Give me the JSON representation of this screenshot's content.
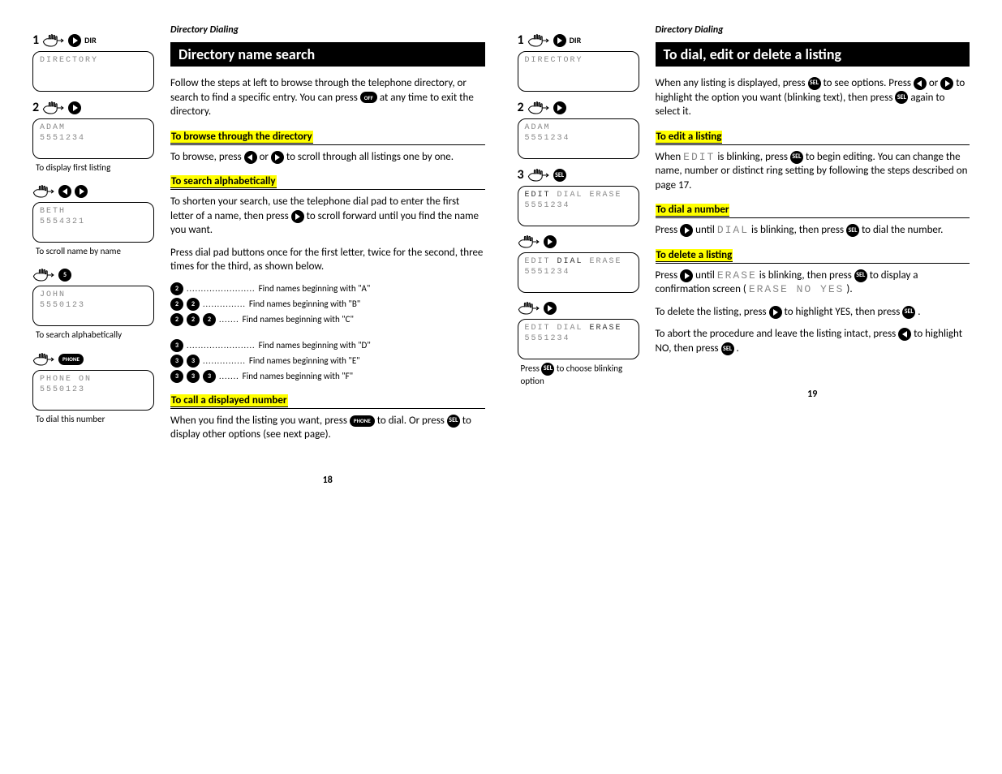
{
  "left": {
    "section": "Directory Dialing",
    "title": "Directory name search",
    "intro1": "Follow the steps at left to browse through the telephone directory, or search to find a specific entry. You can press ",
    "intro2": " at any time to exit the directory.",
    "off_label": "OFF",
    "sub_browse": "To browse through the directory",
    "browse1": "To browse, press ",
    "browse2": " or ",
    "browse3": " to scroll through all listings one by one.",
    "sub_search": "To search alphabetically",
    "search1": "To shorten your search, use the telephone dial pad to enter the first letter of a name, then press ",
    "search2": " to scroll forward until you find the name you want.",
    "search3": "Press dial pad buttons once for the first letter, twice for the second, three times for the third, as shown below.",
    "key2": "2",
    "key3": "3",
    "find_a": "Find names beginning with \"A\"",
    "find_b": "Find names beginning with \"B\"",
    "find_c": "Find names beginning with \"C\"",
    "find_d": "Find names beginning with \"D\"",
    "find_e": "Find names beginning with \"E\"",
    "find_f": "Find names beginning with \"F\"",
    "sub_call": "To call a displayed number",
    "call1": "When you find the listing you want, press ",
    "call2": " to dial. Or press ",
    "call3": " to display other options (see next page).",
    "phone_label": "PHONE",
    "sel_label": "SEL",
    "pagenum": "18",
    "sidebar": {
      "dir_label": "DIR",
      "s1_lcd": "DIRECTORY",
      "s2_lcd1": "ADAM",
      "s2_lcd2": "5551234",
      "s2_cap": "To display first listing",
      "s3_lcd1": "BETH",
      "s3_lcd2": "5554321",
      "s3_cap": "To scroll name by name",
      "key5": "5",
      "s4_lcd1": "JOHN",
      "s4_lcd2": "5550123",
      "s4_cap": "To search alphabetically",
      "s5_lcd1": "PHONE ON",
      "s5_lcd2": "5550123",
      "s5_cap": "To dial this number"
    }
  },
  "right": {
    "section": "Directory Dialing",
    "title": "To dial, edit or delete a listing",
    "intro1": "When any listing is displayed, press ",
    "intro2": " to see options. Press ",
    "intro3": " or ",
    "intro4": " to highlight the option you want (blinking text), then press ",
    "intro5": " again to select it.",
    "sel_label": "SEL",
    "sub_edit": "To edit a listing",
    "edit1a": "When ",
    "edit_word": "EDIT",
    "edit1b": " is blinking, press ",
    "edit1c": " to begin editing. You can change the name, number or distinct ring setting by following the steps described on page 17.",
    "sub_dial": "To dial a number",
    "dial1a": "Press ",
    "dial1b": " until ",
    "dial_word": "DIAL",
    "dial1c": " is blinking, then press ",
    "dial1d": " to dial the number.",
    "sub_delete": "To delete a listing",
    "del1a": "Press ",
    "del1b": " until ",
    "erase_word": "ERASE",
    "del1c": " is blinking, then press ",
    "del1d": " to display a confirmation screen (",
    "erase_prompt": "ERASE NO YES",
    "del1e": ").",
    "del2a": "To delete the listing, press ",
    "del2b": " to highlight YES, then press ",
    "del2c": ".",
    "del3a": "To abort the procedure and leave the listing intact, press ",
    "del3b": " to highlight NO, then press ",
    "del3c": ".",
    "pagenum": "19",
    "sidebar": {
      "dir_label": "DIR",
      "s1_lcd": "DIRECTORY",
      "s2_lcd1": "ADAM",
      "s2_lcd2": "5551234",
      "s3_l1a": "EDIT",
      "s3_l1b": " DIAL ERASE",
      "s3_lcd2": "5551234",
      "s4_l1a": "EDIT ",
      "s4_l1b": "DIAL",
      "s4_l1c": " ERASE",
      "s4_lcd2": "5551234",
      "s5_l1a": "EDIT DIAL ",
      "s5_l1b": "ERASE",
      "s5_lcd2": "5551234",
      "s5_cap": "Press       to choose blinking option",
      "sel_label": "SEL"
    }
  }
}
